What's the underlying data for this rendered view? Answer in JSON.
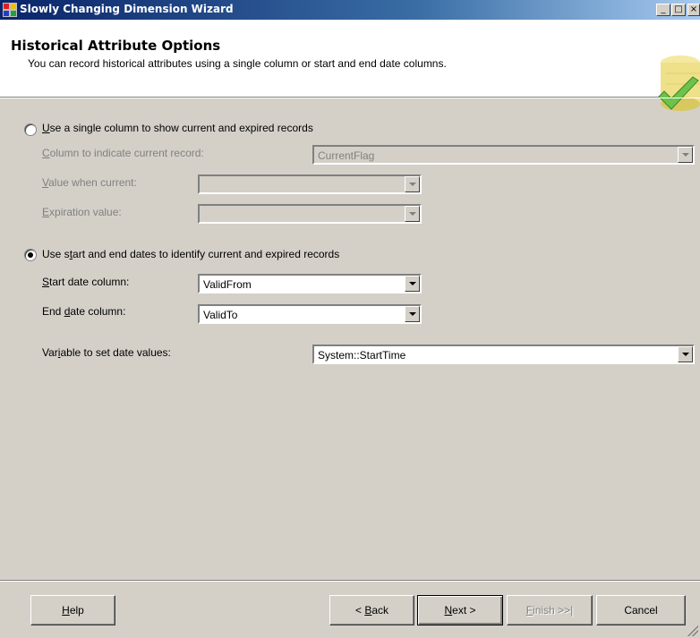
{
  "window": {
    "title": "Slowly Changing Dimension Wizard",
    "controls": {
      "minimize": "_",
      "maximize": "□",
      "close": "×"
    }
  },
  "header": {
    "title": "Historical Attribute Options",
    "subtitle": "You can record historical attributes using a single column or start and end date columns.",
    "graphic_icon": "database-check-icon"
  },
  "single_column": {
    "radio": {
      "pre": "",
      "u": "U",
      "post": "se a single column to show current and expired records",
      "selected": false
    },
    "current_record": {
      "pre": "",
      "u": "C",
      "post": "olumn to indicate current record:",
      "value": "CurrentFlag",
      "enabled": false
    },
    "value_current": {
      "pre": "",
      "u": "V",
      "post": "alue when current:",
      "value": "",
      "enabled": false
    },
    "expiration": {
      "pre": "",
      "u": "E",
      "post": "xpiration value:",
      "value": "",
      "enabled": false
    }
  },
  "dates": {
    "radio": {
      "pre": "Use s",
      "u": "t",
      "post": "art and end dates to identify current and expired records",
      "selected": true
    },
    "start_date": {
      "pre": "",
      "u": "S",
      "post": "tart date column:",
      "value": "ValidFrom"
    },
    "end_date": {
      "pre": "End ",
      "u": "d",
      "post": "ate column:",
      "value": "ValidTo"
    },
    "variable": {
      "pre": "Var",
      "u": "i",
      "post": "able to set date values:",
      "value": "System::StartTime"
    }
  },
  "buttons": {
    "help": {
      "pre": "",
      "u": "H",
      "post": "elp"
    },
    "back": {
      "pre": "< ",
      "u": "B",
      "post": "ack"
    },
    "next": {
      "pre": "",
      "u": "N",
      "post": "ext >"
    },
    "finish": {
      "pre": "",
      "u": "F",
      "post": "inish >>|",
      "enabled": false
    },
    "cancel": {
      "pre": "",
      "u": "",
      "post": "Cancel"
    }
  },
  "colors": {
    "titlebar_start": "#0a246a",
    "titlebar_end": "#a6caf0",
    "face": "#d4d0c8",
    "disabled_text": "#808080"
  }
}
